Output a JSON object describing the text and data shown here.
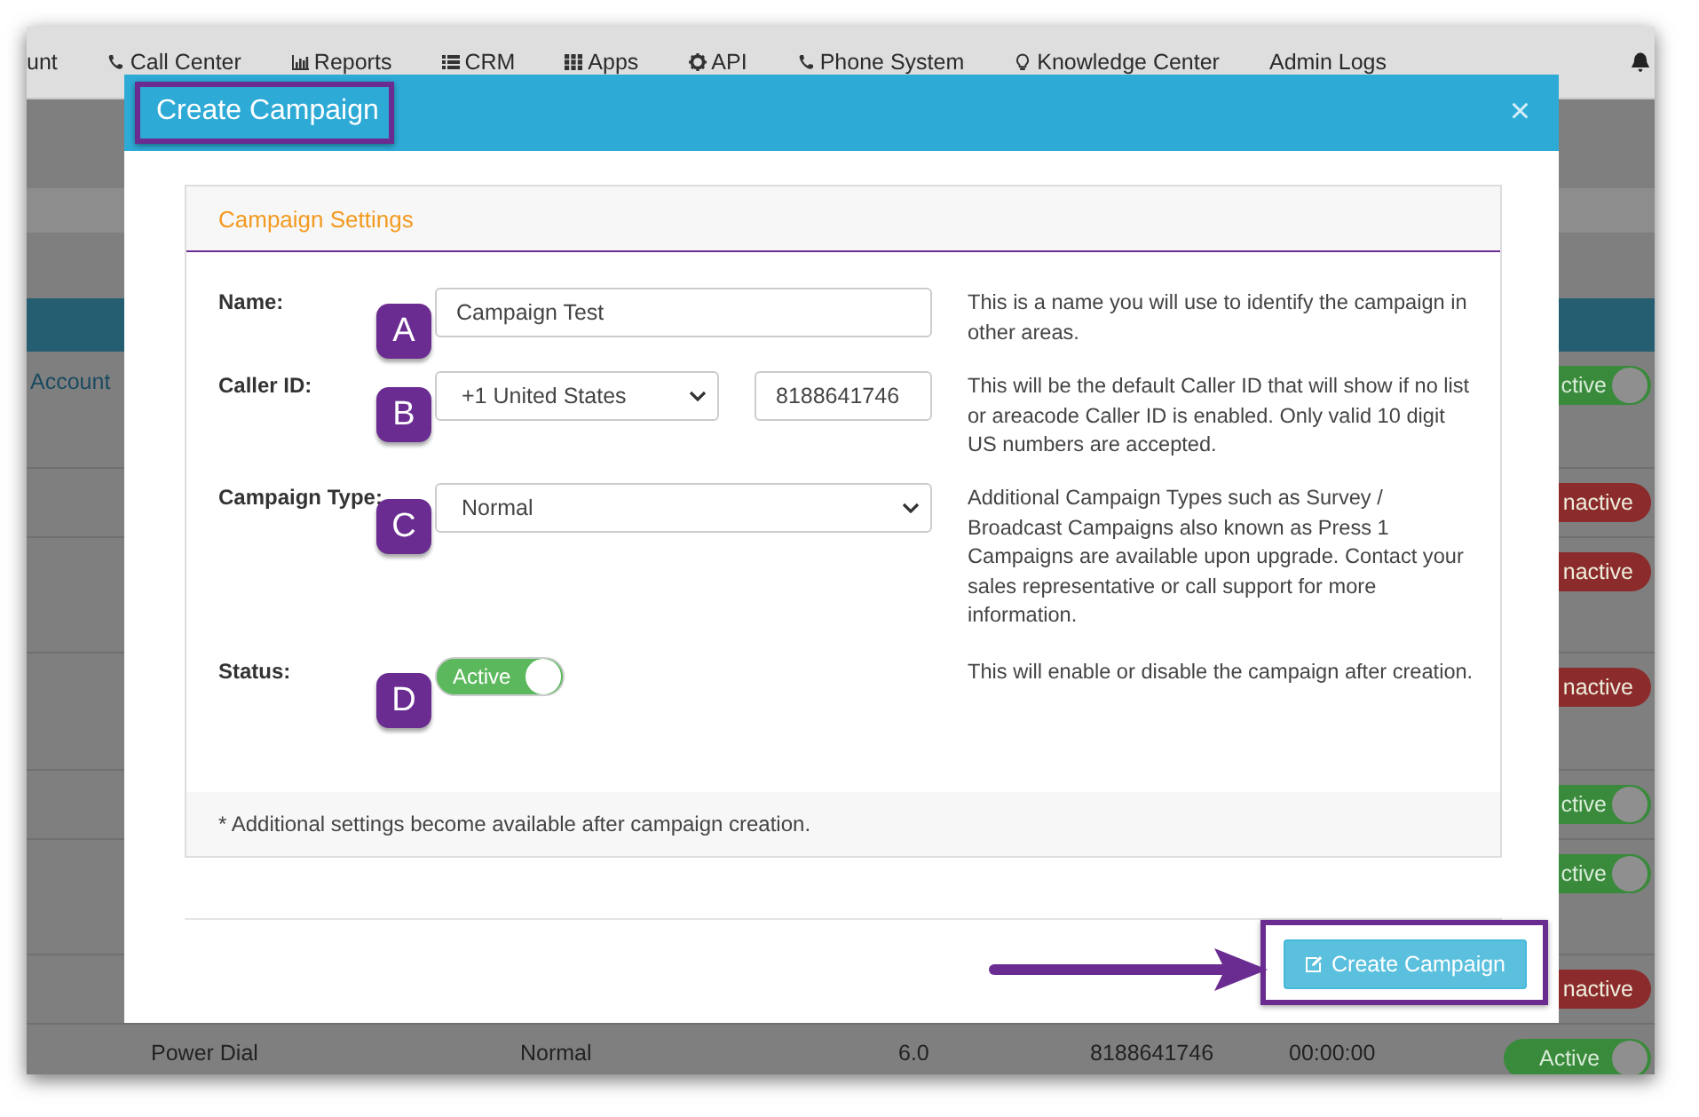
{
  "nav": {
    "items": [
      "unt",
      "Call Center",
      "Reports",
      "CRM",
      "Apps",
      "API",
      "Phone System",
      "Knowledge Center",
      "Admin Logs"
    ]
  },
  "background_table": {
    "rows": [
      {
        "column_1": "Account",
        "status": "ctive",
        "on": true
      },
      {
        "status": "nactive",
        "on": false
      },
      {
        "status": "nactive",
        "on": false
      },
      {
        "status": "nactive",
        "on": false
      },
      {
        "status": "ctive",
        "on": true
      },
      {
        "status": "ctive",
        "on": true
      },
      {
        "status": "nactive",
        "on": false
      }
    ],
    "last_row": {
      "cells": [
        "Power Dial",
        "Normal",
        "6.0",
        "8188641746",
        "00:00:00"
      ],
      "status": "Active",
      "on": true
    }
  },
  "modal": {
    "title": "Create Campaign",
    "close": "×",
    "panel": {
      "title": "Campaign Settings",
      "fields": [
        {
          "kind": "text",
          "label": "Name:",
          "marker": "A",
          "value": "Campaign Test",
          "help": "This is a name you will use to identify the campaign in other areas."
        },
        {
          "kind": "caller",
          "label": "Caller ID:",
          "marker": "B",
          "select": "+1 United States",
          "value": "8188641746",
          "help": "This will be the default Caller ID that will show if no list or areacode Caller ID is enabled. Only valid 10 digit US numbers are accepted."
        },
        {
          "kind": "select",
          "label": "Campaign Type:",
          "marker": "C",
          "select": "Normal",
          "help": "Additional Campaign Types such as Survey / Broadcast Campaigns also known as Press 1 Campaigns are available upon upgrade. Contact your sales representative or call support for more information."
        },
        {
          "kind": "toggle",
          "label": "Status:",
          "marker": "D",
          "toggle_label": "Active",
          "on": true,
          "help": "This will enable or disable the campaign after creation."
        }
      ],
      "note": "* Additional settings become available after campaign creation."
    },
    "button": "Create Campaign"
  }
}
